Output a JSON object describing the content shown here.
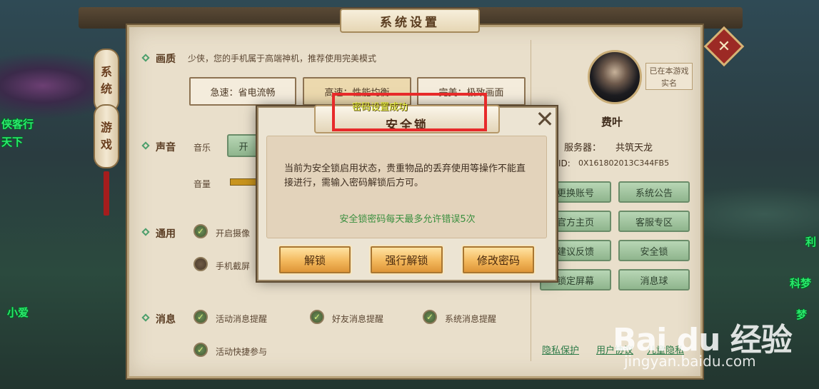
{
  "background": {
    "left_texts": [
      "侠客行",
      "天下",
      "小爱"
    ],
    "right_texts": [
      "利",
      "科梦",
      "梦"
    ]
  },
  "panel": {
    "title": "系统设置",
    "side_tabs": [
      {
        "label_top": "系",
        "label_bottom": "统"
      },
      {
        "label_top": "游",
        "label_bottom": "戏"
      }
    ],
    "quality": {
      "label": "画质",
      "description": "少侠，您的手机属于高端神机，推荐使用完美模式",
      "options": [
        "急速：省电流畅",
        "高速：性能均衡",
        "完美：极致画面"
      ]
    },
    "sound": {
      "label": "声音",
      "music_label": "音乐",
      "music_on": "开",
      "volume_label": "音量"
    },
    "general": {
      "label": "通用",
      "options": [
        "开启摄像",
        "手机截屏"
      ]
    },
    "message": {
      "label": "消息",
      "options": [
        "活动消息提醒",
        "好友消息提醒",
        "系统消息提醒",
        "活动快捷参与"
      ]
    },
    "account": {
      "realname_badge": "已在本游戏实名",
      "player_name": "费叶",
      "server_label": "服务器：",
      "server_name": "共筑天龙",
      "id_label": "ID:",
      "id_value": "0X161802013C344FB5",
      "buttons": [
        "更换账号",
        "系统公告",
        "官方主页",
        "客服专区",
        "建议反馈",
        "安全锁",
        "锁定屏幕",
        "消息球"
      ],
      "links": [
        "隐私保护",
        "用户协议",
        "儿童隐私"
      ]
    }
  },
  "modal": {
    "title": "安全锁",
    "toast": "密码设置成功",
    "message": "当前为安全锁启用状态，贵重物品的丢弃使用等操作不能直接进行，需输入密码解锁后方可。",
    "hint": "安全锁密码每天最多允许错误5次",
    "buttons": {
      "unlock": "解锁",
      "force_unlock": "强行解锁",
      "change_password": "修改密码"
    },
    "close_glyph": "✕"
  },
  "watermark": {
    "logo": "Bai du 经验",
    "url": "jingyan.baidu.com"
  },
  "colors": {
    "panel_bg": "#e9dfcb",
    "accent_green": "#3a8f3f",
    "button_gold": "#f3b85c",
    "highlight_red": "#e72a2a",
    "toast_yellow": "#e6f03c"
  }
}
